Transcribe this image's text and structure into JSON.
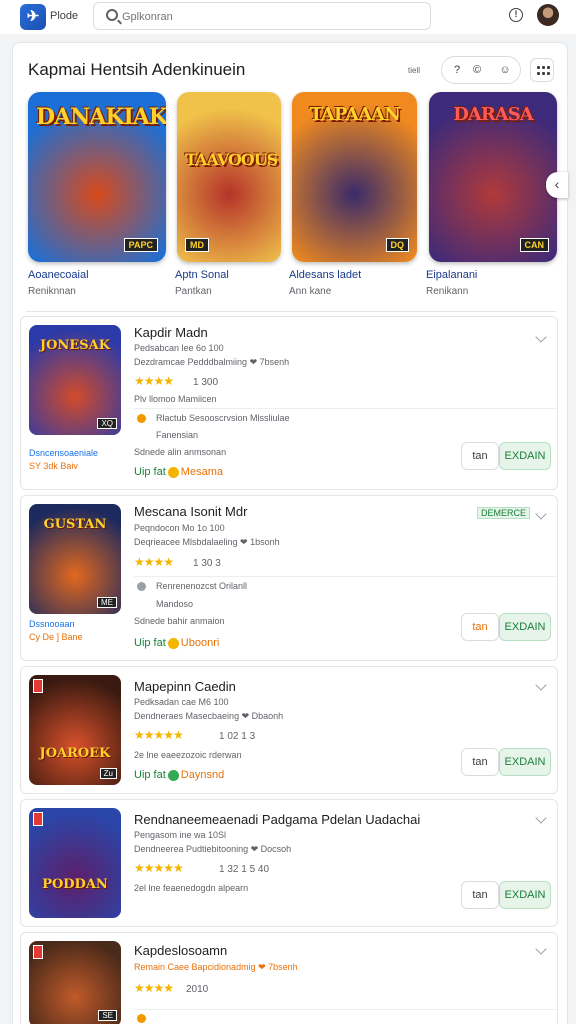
{
  "topbar": {
    "logo_text": "Plode",
    "search_placeholder": "Gplkonran",
    "avatar_name": "avatar"
  },
  "section": {
    "title": "Kapmai Hentsih Adenkinuein",
    "tiny_tag": "tiell",
    "controls": [
      "?",
      "©",
      "☺"
    ]
  },
  "featured": [
    {
      "art_text": "DANAKIAK",
      "badge": "PAPC",
      "name": "Aoanecoaial",
      "sub": "Reniknnan",
      "color_a": "#1b6fd6",
      "color_b": "#d84a1b"
    },
    {
      "art_text": "TAAVOOUS",
      "badge": "MD",
      "name": "Aptn Sonal",
      "sub": "Pantkan",
      "color_a": "#f0c24a",
      "color_b": "#b5332a"
    },
    {
      "art_text": "TAPAAAN",
      "badge": "DQ",
      "name": "Aldesans ladet",
      "sub": "Ann kane",
      "color_a": "#f08a1f",
      "color_b": "#3a2b6a"
    },
    {
      "art_text": "DARASA",
      "badge": "CAN",
      "name": "Eipalanani",
      "sub": "Renikann",
      "color_a": "#3d2a7a",
      "color_b": "#b03a3a"
    }
  ],
  "rows": [
    {
      "title": "Kapdir Madn",
      "line1": "Pedsabcan lee 6o 100",
      "line2": "Dezdramcae Pedddbalmiing ❤ 7bsenh",
      "stars": "★★★★",
      "rating": "1 300",
      "line3": "Plv llomoo Mamiicen",
      "info1": "Rlactub Sesooscrvsion Mlssliulae",
      "info2": "Fanensian",
      "info3": "Sdnede alin anmsonan",
      "left1": "Dsncensoaeniale",
      "left2": "SY 3dk Baiv",
      "upfor": "Uip fat",
      "upfor_gold": "Mesama",
      "btn1": "tan",
      "btn2": "EXDAIN",
      "art_text": "JONESAK",
      "badge": "XQ",
      "col_a": "#2a3aa8",
      "col_b": "#d24b2a"
    },
    {
      "title": "Mescana Isonit Mdr",
      "line1": "Peqndocon Mo 1o 100",
      "line2": "Deqrieacee Mlsbdalaeling ❤ 1bsonh",
      "stars": "★★★★",
      "rating": "1 30 3",
      "line3": "",
      "info1": "Renrenenozcst Orilanll",
      "info2": "Mandoso",
      "info3": "Sdnede bahir anmaion",
      "left1": "Dssnooaan",
      "left2": "Cy De ] Bane",
      "upfor": "Uip fat",
      "upfor_gold": "Uboonri",
      "btn1": "tan",
      "btn2": "EXDAIN",
      "tag": "DEMERCE",
      "art_text": "GUSTAN",
      "badge": "ME",
      "col_a": "#1d2a5e",
      "col_b": "#e2681e"
    },
    {
      "title": "Mapepinn Caedin",
      "line1": "Pedksadan cae M6 100",
      "line2": "Dendneraes Masecbaeing ❤ Dbaonh",
      "stars": "★★★★★",
      "rating": "1 02 1 3",
      "line3": "2e lne eaeezozoic rderwan",
      "upfor": "Uip fat",
      "upfor_gold": "Daynsnd",
      "btn1": "tan",
      "btn2": "EXDAIN",
      "art_text": "JOAROEK",
      "badge": "Zu",
      "col_a": "#3a1a10",
      "col_b": "#d9512b"
    },
    {
      "title": "Rendnaneemeaenadi Padgama Pdelan Uadachai",
      "line1": "Pengasom ine wa 10Sl",
      "line2": "Dendneerea Pudtiebitooning ❤ Docsoh",
      "stars": "★★★★★",
      "rating": "1 32 1 5 40",
      "line3": "2el lne feaenedogdn alpearn",
      "btn1": "tan",
      "btn2": "EXDAIN",
      "art_text": "PODDAN",
      "badge": "",
      "col_a": "#2a46a8",
      "col_b": "#5d1f6a"
    },
    {
      "title": "Kapdeslosoamn",
      "line1": "",
      "line2": "Remain Caee Bapcidionadmig ❤ 7bsenh",
      "stars": "★★★★",
      "rating": "2010",
      "art_text": "",
      "badge": "SE",
      "col_a": "#4a2a1a",
      "col_b": "#c05a2a"
    }
  ]
}
